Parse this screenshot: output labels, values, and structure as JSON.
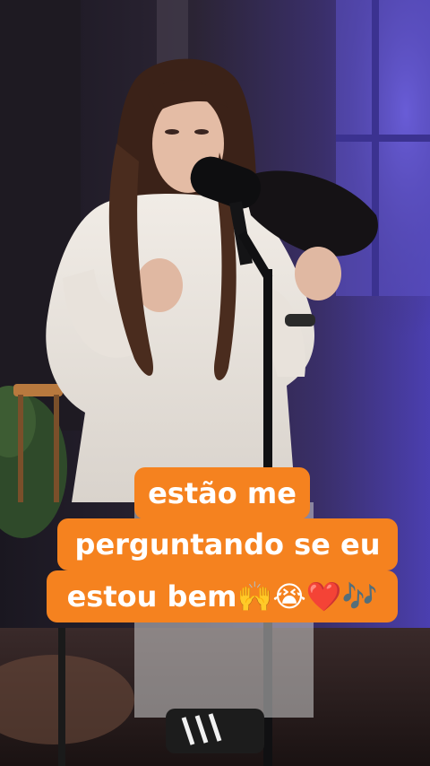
{
  "caption": {
    "lines": [
      "estão me",
      "perguntando se eu",
      "estou bem🙌😭❤️🎶"
    ]
  },
  "colors": {
    "caption_bg": "#f5821f",
    "caption_text": "#ffffff",
    "backdrop": "#2a2435",
    "window_glow": "#6a5fd8"
  }
}
